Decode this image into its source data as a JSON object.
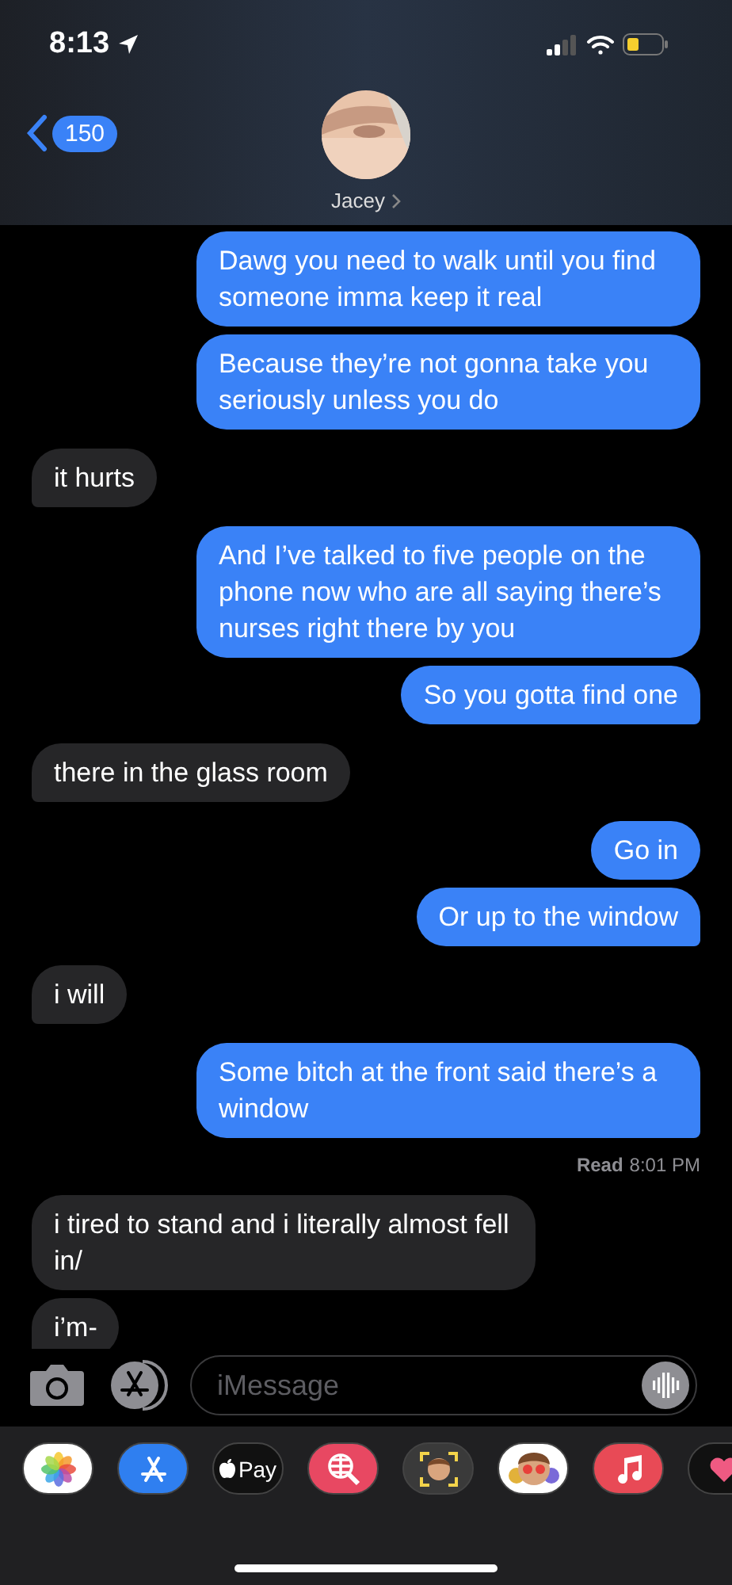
{
  "status_bar": {
    "time": "8:13"
  },
  "header": {
    "back_count": "150",
    "contact_name": "Jacey"
  },
  "messages": [
    {
      "kind": "sent",
      "text": "Dawg you need to walk until you find someone imma keep it real",
      "tail": false
    },
    {
      "kind": "sent",
      "text": "Because they’re not gonna take you seriously unless you do",
      "tail": false
    },
    {
      "kind": "received",
      "text": "it hurts",
      "tail": true
    },
    {
      "kind": "sent",
      "text": "And I’ve talked to five people on the phone now who are all saying there’s nurses right there by you",
      "tail": false
    },
    {
      "kind": "sent",
      "text": "So you gotta find one",
      "tail": true
    },
    {
      "kind": "received",
      "text": "there in the glass room",
      "tail": true
    },
    {
      "kind": "sent",
      "text": "Go in",
      "tail": false
    },
    {
      "kind": "sent",
      "text": "Or up to the window",
      "tail": true
    },
    {
      "kind": "received",
      "text": "i will",
      "tail": true
    },
    {
      "kind": "sent",
      "text": "Some bitch at the front said there’s a window",
      "tail": true
    },
    {
      "kind": "receipt",
      "label": "Read",
      "time": "8:01 PM"
    },
    {
      "kind": "received",
      "text": "i tired to stand and i literally almost fell in/",
      "tail": false
    },
    {
      "kind": "received",
      "text": "i’m-",
      "tail": true
    }
  ],
  "composer": {
    "placeholder": "iMessage"
  },
  "app_drawer": [
    {
      "kind": "photos"
    },
    {
      "kind": "appstore"
    },
    {
      "kind": "pay",
      "label": "Pay"
    },
    {
      "kind": "search"
    },
    {
      "kind": "memoji"
    },
    {
      "kind": "stickers"
    },
    {
      "kind": "music"
    },
    {
      "kind": "heart"
    }
  ]
}
